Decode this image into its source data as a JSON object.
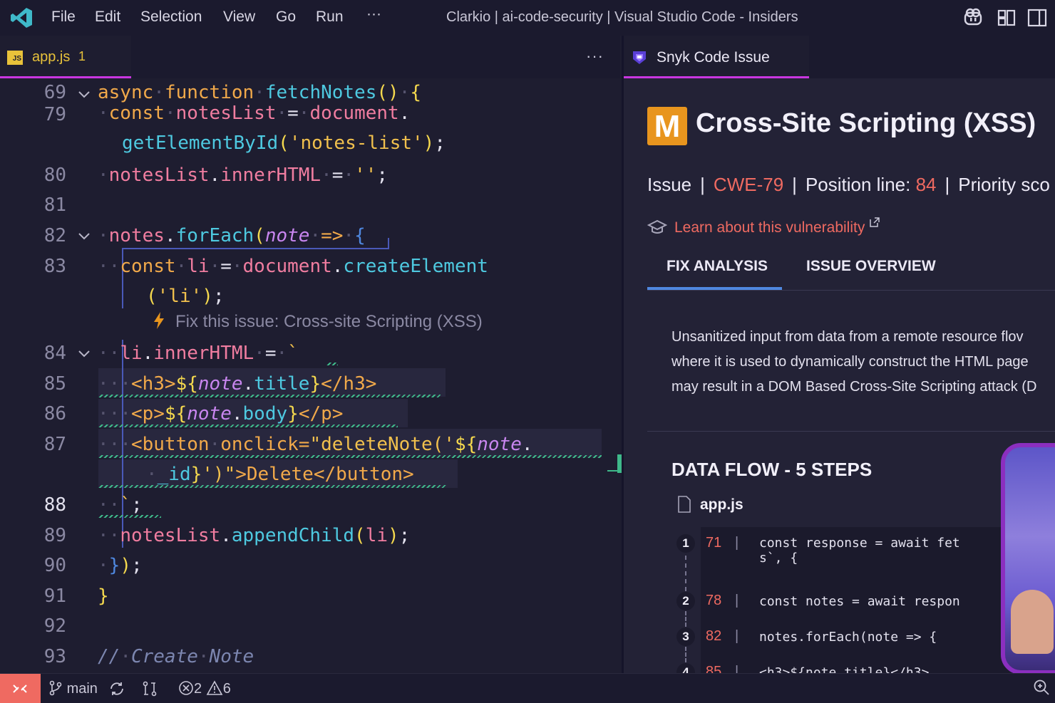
{
  "titlebar": {
    "menus": [
      "File",
      "Edit",
      "Selection",
      "View",
      "Go",
      "Run",
      "···"
    ],
    "title": "Clarkio | ai-code-security | Visual Studio Code - Insiders"
  },
  "editor_tab": {
    "filename": "app.js",
    "problems": "1",
    "more": "···"
  },
  "panel_tab": {
    "label": "Snyk Code Issue"
  },
  "editor": {
    "line_numbers": [
      "69",
      "79",
      "",
      "80",
      "81",
      "82",
      "83",
      "",
      "84",
      "85",
      "86",
      "87",
      "",
      "88",
      "89",
      "90",
      "91",
      "92",
      "93"
    ],
    "codelens": "Fix this issue: Cross-site Scripting (XSS)"
  },
  "issue": {
    "severity_letter": "M",
    "title": "Cross-Site Scripting (XSS)",
    "type": "Issue",
    "cwe": "CWE-79",
    "position_label": "Position line:",
    "position_value": "84",
    "priority": "Priority sco",
    "learn_link": "Learn about this vulnerability",
    "tabs": [
      "FIX ANALYSIS",
      "ISSUE OVERVIEW"
    ],
    "description": [
      "Unsanitized input from data from a remote resource flov",
      "where it is used to dynamically construct the HTML page",
      "may result in a DOM Based Cross-Site Scripting attack (D"
    ],
    "data_flow_title": "DATA FLOW - 5 STEPS",
    "data_flow_file": "app.js",
    "steps": [
      {
        "n": "1",
        "line": "71",
        "code": "const response = await fet\ns`, {"
      },
      {
        "n": "2",
        "line": "78",
        "code": "const notes = await respon"
      },
      {
        "n": "3",
        "line": "82",
        "code": "notes.forEach(note => {"
      },
      {
        "n": "4",
        "line": "85",
        "code": "<h3>${note.title}</h3>"
      }
    ]
  },
  "status": {
    "branch": "main",
    "errors": "2",
    "warnings": "6"
  },
  "colors": {
    "accent": "#c936e0",
    "severity_medium": "#e8951e",
    "link_red": "#ef6a61",
    "tab_underline": "#4f88e0",
    "remote_bg": "#ef6a61"
  }
}
